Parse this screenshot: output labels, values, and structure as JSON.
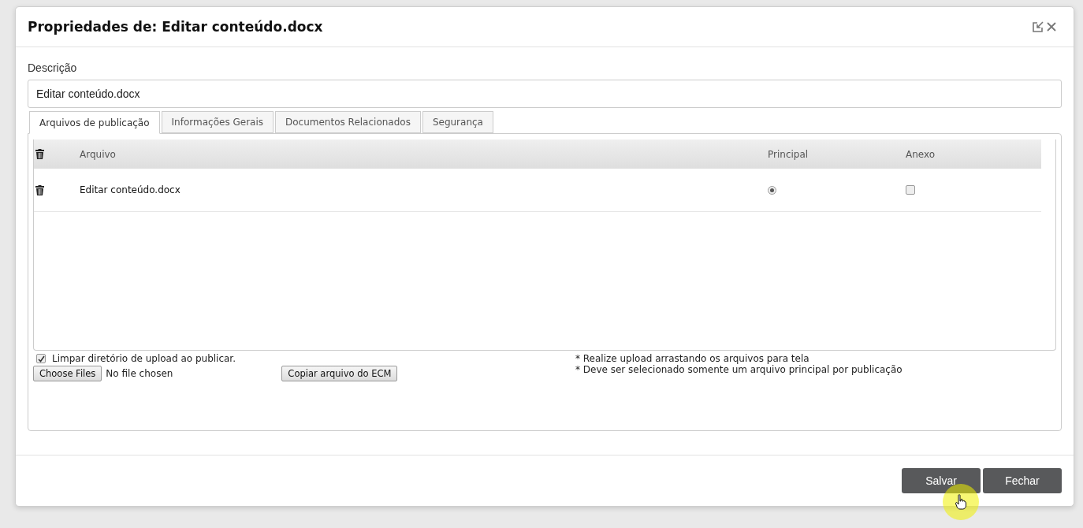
{
  "dialog": {
    "title": "Propriedades de: Editar conteúdo.docx",
    "description": {
      "label": "Descrição",
      "value": "Editar conteúdo.docx"
    },
    "tabs": [
      {
        "label": "Arquivos de publicação",
        "selected": true
      },
      {
        "label": "Informações Gerais",
        "selected": false
      },
      {
        "label": "Documentos Relacionados",
        "selected": false
      },
      {
        "label": "Segurança",
        "selected": false
      }
    ],
    "table": {
      "columns": [
        "Arquivo",
        "Principal",
        "Anexo"
      ],
      "rows": [
        {
          "file": "Editar conteúdo.docx",
          "principal_selected": true,
          "anexo_checked": false
        }
      ]
    },
    "clear_upload": {
      "label": "Limpar diretório de upload ao publicar.",
      "checked": true
    },
    "file_picker": {
      "button": "Choose Files",
      "status": "No file chosen"
    },
    "copy_button": "Copiar arquivo do ECM",
    "notes": [
      "* Realize upload arrastando os arquivos para tela",
      "* Deve ser selecionado somente um arquivo principal por publicação"
    ],
    "buttons": [
      "Salvar",
      "Fechar"
    ]
  }
}
